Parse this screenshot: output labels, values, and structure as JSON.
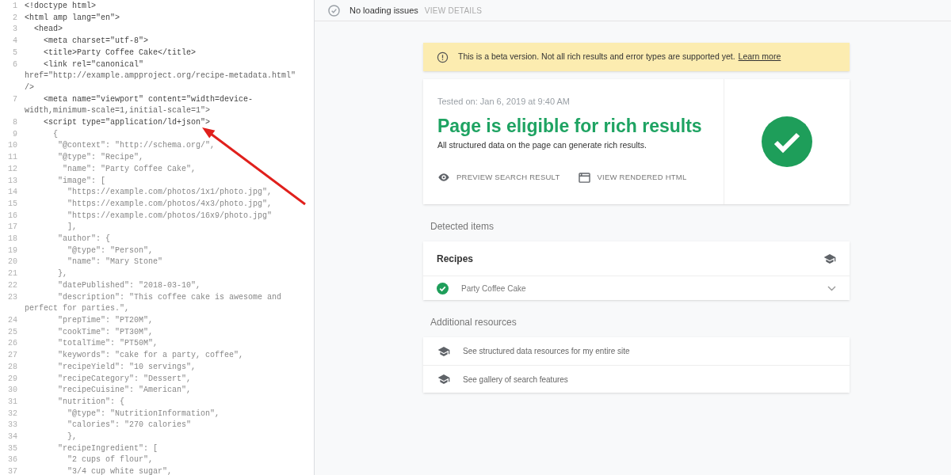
{
  "code_lines": [
    {
      "number": "1",
      "kind": "markup",
      "text": "<!doctype html>"
    },
    {
      "number": "2",
      "kind": "markup",
      "text": "<html amp lang=\"en\">"
    },
    {
      "number": "3",
      "kind": "markup",
      "text": "  <head>"
    },
    {
      "number": "4",
      "kind": "markup",
      "text": "    <meta charset=\"utf-8\">"
    },
    {
      "number": "5",
      "kind": "markup",
      "text": "    <title>Party Coffee Cake</title>"
    },
    {
      "number": "6",
      "kind": "markup",
      "text": "    <link rel=\"canonical\"",
      "continued": [
        "href=\"http://example.ampproject.org/recipe-metadata.html\"",
        "/>"
      ]
    },
    {
      "number": "7",
      "kind": "markup",
      "text": "    <meta name=\"viewport\" content=\"width=device-",
      "continued": [
        "width,minimum-scale=1,initial-scale=1\">"
      ]
    },
    {
      "number": "8",
      "kind": "markup",
      "text": "    <script type=\"application/ld+json\">"
    },
    {
      "number": "9",
      "kind": "json",
      "text": "      {"
    },
    {
      "number": "10",
      "kind": "json",
      "text": "       \"@context\": \"http://schema.org/\","
    },
    {
      "number": "11",
      "kind": "json",
      "text": "       \"@type\": \"Recipe\","
    },
    {
      "number": "12",
      "kind": "json",
      "text": "        \"name\": \"Party Coffee Cake\","
    },
    {
      "number": "13",
      "kind": "json",
      "text": "       \"image\": ["
    },
    {
      "number": "14",
      "kind": "json",
      "text": "         \"https://example.com/photos/1x1/photo.jpg\","
    },
    {
      "number": "15",
      "kind": "json",
      "text": "         \"https://example.com/photos/4x3/photo.jpg\","
    },
    {
      "number": "16",
      "kind": "json",
      "text": "         \"https://example.com/photos/16x9/photo.jpg\""
    },
    {
      "number": "17",
      "kind": "json",
      "text": "         ],"
    },
    {
      "number": "18",
      "kind": "json",
      "text": "       \"author\": {"
    },
    {
      "number": "19",
      "kind": "json",
      "text": "         \"@type\": \"Person\","
    },
    {
      "number": "20",
      "kind": "json",
      "text": "         \"name\": \"Mary Stone\""
    },
    {
      "number": "21",
      "kind": "json",
      "text": "       },"
    },
    {
      "number": "22",
      "kind": "json",
      "text": "       \"datePublished\": \"2018-03-10\","
    },
    {
      "number": "23",
      "kind": "json",
      "text": "       \"description\": \"This coffee cake is awesome and",
      "continued": [
        "perfect for parties.\","
      ]
    },
    {
      "number": "24",
      "kind": "json",
      "text": "       \"prepTime\": \"PT20M\","
    },
    {
      "number": "25",
      "kind": "json",
      "text": "       \"cookTime\": \"PT30M\","
    },
    {
      "number": "26",
      "kind": "json",
      "text": "       \"totalTime\": \"PT50M\","
    },
    {
      "number": "27",
      "kind": "json",
      "text": "       \"keywords\": \"cake for a party, coffee\","
    },
    {
      "number": "28",
      "kind": "json",
      "text": "       \"recipeYield\": \"10 servings\","
    },
    {
      "number": "29",
      "kind": "json",
      "text": "       \"recipeCategory\": \"Dessert\","
    },
    {
      "number": "30",
      "kind": "json",
      "text": "       \"recipeCuisine\": \"American\","
    },
    {
      "number": "31",
      "kind": "json",
      "text": "       \"nutrition\": {"
    },
    {
      "number": "32",
      "kind": "json",
      "text": "         \"@type\": \"NutritionInformation\","
    },
    {
      "number": "33",
      "kind": "json",
      "text": "         \"calories\": \"270 calories\""
    },
    {
      "number": "34",
      "kind": "json",
      "text": "         },"
    },
    {
      "number": "35",
      "kind": "json",
      "text": "       \"recipeIngredient\": ["
    },
    {
      "number": "36",
      "kind": "json",
      "text": "         \"2 cups of flour\","
    },
    {
      "number": "37",
      "kind": "json",
      "text": "         \"3/4 cup white sugar\","
    }
  ],
  "status_bar": {
    "label": "No loading issues",
    "action": "VIEW DETAILS"
  },
  "banner": {
    "text": "This is a beta version. Not all rich results and error types are supported yet.",
    "link": "Learn more"
  },
  "result": {
    "tested_on": "Tested on: Jan 6, 2019 at 9:40 AM",
    "heading": "Page is eligible for rich results",
    "subtitle": "All structured data on the page can generate rich results.",
    "actions": [
      {
        "kind": "preview",
        "label": "PREVIEW SEARCH RESULT"
      },
      {
        "kind": "html",
        "label": "VIEW RENDERED HTML"
      }
    ]
  },
  "detected": {
    "title": "Detected items",
    "group": "Recipes",
    "items": [
      {
        "label": "Party Coffee Cake",
        "valid": true
      }
    ]
  },
  "resources": {
    "title": "Additional resources",
    "items": [
      "See structured data resources for my entire site",
      "See gallery of search features"
    ]
  }
}
